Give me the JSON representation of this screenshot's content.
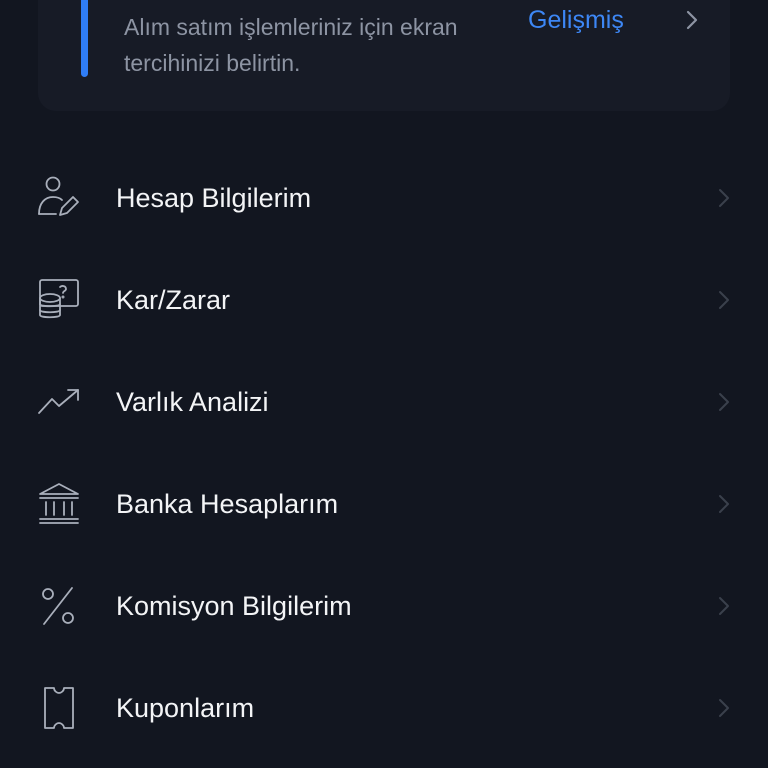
{
  "preference_card": {
    "description": "Alım satım işlemleriniz için ekran tercihinizi belirtin.",
    "link_label": "Gelişmiş",
    "link_icon": "chevron-right-icon",
    "accent_color": "#2f7df6"
  },
  "menu": {
    "items": [
      {
        "label": "Hesap Bilgilerim",
        "icon": "user-edit-icon"
      },
      {
        "label": "Kar/Zarar",
        "icon": "profit-loss-icon"
      },
      {
        "label": "Varlık Analizi",
        "icon": "trend-up-icon"
      },
      {
        "label": "Banka Hesaplarım",
        "icon": "bank-icon"
      },
      {
        "label": "Komisyon Bilgilerim",
        "icon": "percent-icon"
      },
      {
        "label": "Kuponlarım",
        "icon": "coupon-icon"
      }
    ],
    "chevron_icon": "chevron-right-icon"
  },
  "colors": {
    "background": "#121620",
    "card": "#171b26",
    "link": "#3d87f5",
    "text": "#f3f4f6",
    "muted_text": "#8d94a3"
  }
}
